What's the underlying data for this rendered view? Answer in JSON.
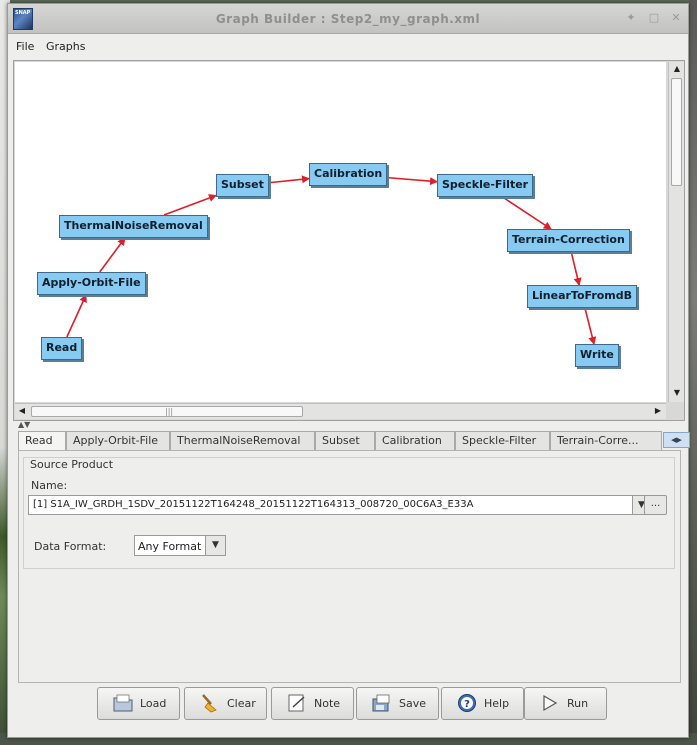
{
  "window": {
    "title": "Graph Builder : Step2_my_graph.xml",
    "app_icon_text": "SNAP",
    "controls": {
      "pin": "✦",
      "maximize": "□",
      "close": "✕"
    }
  },
  "menu": {
    "items": [
      "File",
      "Graphs"
    ]
  },
  "graph": {
    "nodes": {
      "read": "Read",
      "apply_orbit": "Apply-Orbit-File",
      "thermal": "ThermalNoiseRemoval",
      "subset": "Subset",
      "calibration": "Calibration",
      "speckle": "Speckle-Filter",
      "terrain": "Terrain-Correction",
      "linear": "LinearToFromdB",
      "write": "Write"
    },
    "edges": [
      [
        "read",
        "apply_orbit"
      ],
      [
        "apply_orbit",
        "thermal"
      ],
      [
        "thermal",
        "subset"
      ],
      [
        "subset",
        "calibration"
      ],
      [
        "calibration",
        "speckle"
      ],
      [
        "speckle",
        "terrain"
      ],
      [
        "terrain",
        "linear"
      ],
      [
        "linear",
        "write"
      ]
    ],
    "edge_color": "#dd1f2a",
    "node_color": "#87cbf2"
  },
  "tabs": {
    "items": [
      "Read",
      "Apply-Orbit-File",
      "ThermalNoiseRemoval",
      "Subset",
      "Calibration",
      "Speckle-Filter",
      "Terrain-Corre..."
    ],
    "active": "Read",
    "scroll_glyph": "◀▶"
  },
  "read_panel": {
    "group_title": "Source Product",
    "name_label": "Name:",
    "product_value": "[1] S1A_IW_GRDH_1SDV_20151122T164248_20151122T164313_008720_00C6A3_E33A",
    "browse_label": "...",
    "format_label": "Data Format:",
    "format_value": "Any Format"
  },
  "buttons": {
    "load": "Load",
    "clear": "Clear",
    "note": "Note",
    "save": "Save",
    "help": "Help",
    "run": "Run"
  }
}
